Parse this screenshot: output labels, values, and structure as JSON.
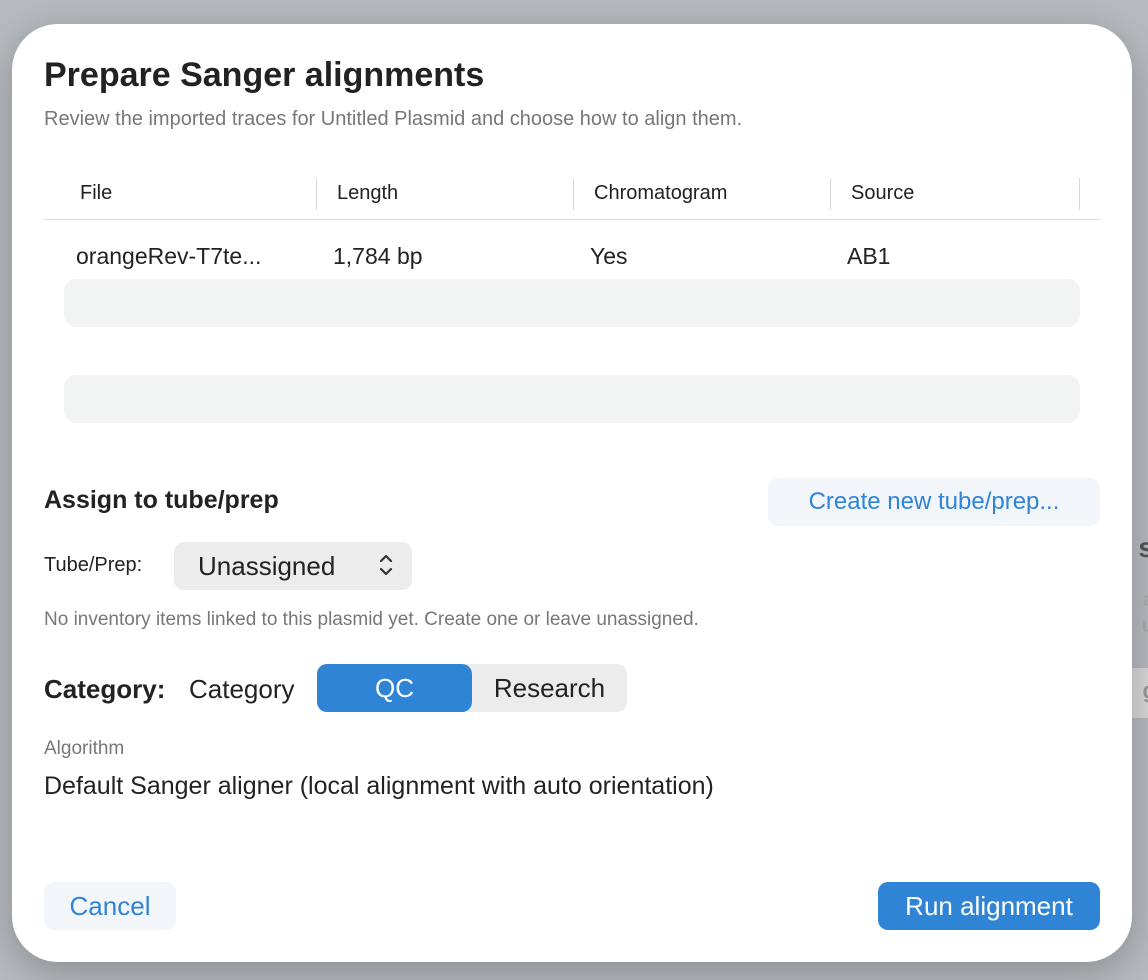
{
  "dialog": {
    "title": "Prepare Sanger alignments",
    "subtitle": "Review the imported traces for Untitled Plasmid and choose how to align them."
  },
  "table": {
    "headers": [
      "File",
      "Length",
      "Chromatogram",
      "Source"
    ],
    "rows": [
      {
        "file": "orangeRev-T7te...",
        "length": "1,784 bp",
        "chromatogram": "Yes",
        "source": "AB1"
      }
    ]
  },
  "assign": {
    "title": "Assign to tube/prep",
    "create_label": "Create new tube/prep...",
    "tube_label": "Tube/Prep:",
    "tube_value": "Unassigned",
    "hint": "No inventory items linked to this plasmid yet. Create one or leave unassigned."
  },
  "category": {
    "label": "Category:",
    "sub_label": "Category",
    "options": [
      "QC",
      "Research"
    ],
    "selected": "QC"
  },
  "algorithm": {
    "label": "Algorithm",
    "value": "Default Sanger aligner (local alignment with auto orientation)"
  },
  "footer": {
    "cancel_label": "Cancel",
    "run_label": "Run alignment"
  },
  "colors": {
    "accent": "#2f84d6",
    "placeholder_row": "#f2f3f3"
  }
}
